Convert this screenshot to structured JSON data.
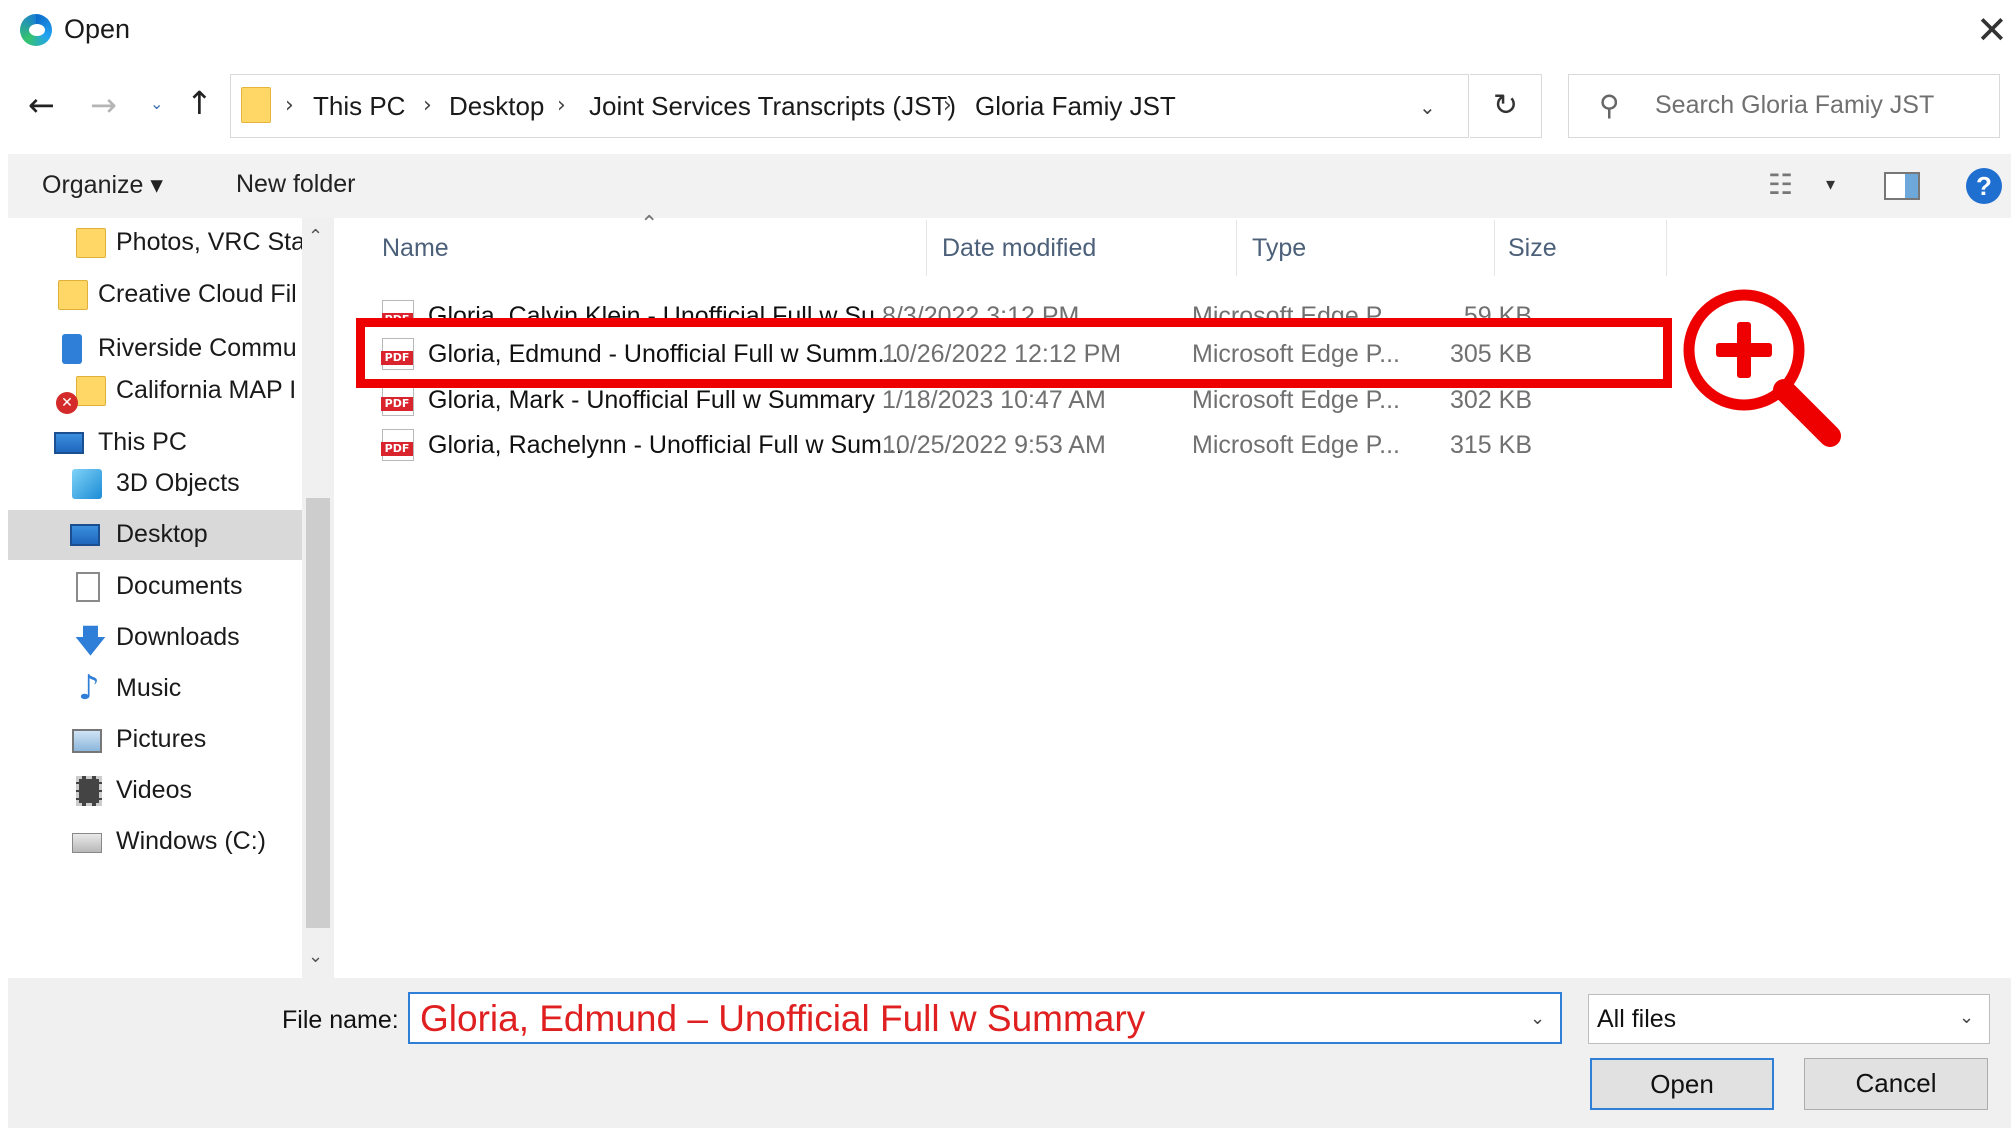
{
  "window": {
    "title": "Open",
    "close_glyph": "✕"
  },
  "nav": {
    "back": "←",
    "forward": "→",
    "recent": "⌄",
    "up": "↑"
  },
  "address": {
    "crumbs": [
      "This PC",
      "Desktop",
      "Joint Services Transcripts (JST)",
      "Gloria Famiy JST"
    ],
    "separator": "›",
    "dropdown": "⌄",
    "refresh": "↻"
  },
  "search": {
    "placeholder": "Search Gloria Famiy JST"
  },
  "toolbar": {
    "organize": "Organize ▾",
    "new_folder": "New folder",
    "view_glyph": "☷",
    "view_drop": "▾",
    "help": "?"
  },
  "sidebar": {
    "items": [
      {
        "label": "Photos, VRC Stat",
        "icon": "folder-icon"
      },
      {
        "label": "Creative Cloud Fil",
        "icon": "creative-cloud-folder-icon"
      },
      {
        "label": "Riverside Commu",
        "icon": "building-icon"
      },
      {
        "label": "California MAP I",
        "icon": "folder-error-icon"
      },
      {
        "label": "This PC",
        "icon": "computer-icon"
      },
      {
        "label": "3D Objects",
        "icon": "cube-icon"
      },
      {
        "label": "Desktop",
        "icon": "desktop-icon",
        "selected": true
      },
      {
        "label": "Documents",
        "icon": "document-icon"
      },
      {
        "label": "Downloads",
        "icon": "download-arrow-icon"
      },
      {
        "label": "Music",
        "icon": "music-note-icon"
      },
      {
        "label": "Pictures",
        "icon": "picture-icon"
      },
      {
        "label": "Videos",
        "icon": "film-icon"
      },
      {
        "label": "Windows (C:)",
        "icon": "drive-icon"
      }
    ],
    "scroll_up": "⌃",
    "scroll_down": "⌄"
  },
  "table": {
    "columns": [
      "Name",
      "Date modified",
      "Type",
      "Size"
    ],
    "sort_glyph": "⌃",
    "rows": [
      {
        "name": "Gloria, Calvin Klein - Unofficial Full w Su...",
        "date": "8/3/2022 3:12 PM",
        "type": "Microsoft Edge P...",
        "size": "59 KB"
      },
      {
        "name": "Gloria, Edmund - Unofficial Full w Summ...",
        "date": "10/26/2022 12:12 PM",
        "type": "Microsoft Edge P...",
        "size": "305 KB"
      },
      {
        "name": "Gloria, Mark - Unofficial Full w Summary",
        "date": "1/18/2023 10:47 AM",
        "type": "Microsoft Edge P...",
        "size": "302 KB"
      },
      {
        "name": "Gloria, Rachelynn - Unofficial Full w Sum...",
        "date": "10/25/2022 9:53 AM",
        "type": "Microsoft Edge P...",
        "size": "315 KB"
      }
    ]
  },
  "footer": {
    "filename_label": "File name:",
    "filename_value": "Gloria, Edmund – Unofficial Full w Summary",
    "filter_value": "All files",
    "dropdown": "⌄",
    "open": "Open",
    "cancel": "Cancel"
  },
  "annotation": {
    "color": "#ee0000"
  }
}
